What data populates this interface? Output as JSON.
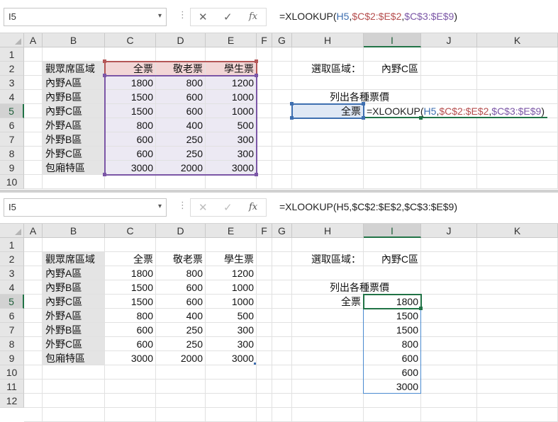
{
  "top": {
    "name_box": "I5",
    "formula_segments": [
      {
        "text": "=XLOOKUP(",
        "color": "#222222"
      },
      {
        "text": "H5",
        "color": "#3e6fb0"
      },
      {
        "text": ",",
        "color": "#222222"
      },
      {
        "text": "$C$2:$E$2",
        "color": "#b54e4e"
      },
      {
        "text": ",",
        "color": "#222222"
      },
      {
        "text": "$C$3:$E$9",
        "color": "#7b56a6"
      },
      {
        "text": ")",
        "color": "#222222"
      }
    ]
  },
  "bottom": {
    "name_box": "I5",
    "formula": "=XLOOKUP(H5,$C$2:$E$2,$C$3:$E$9)"
  },
  "toolbar": {
    "cancel_glyph": "✕",
    "enter_glyph": "✓",
    "fx_label": "fx",
    "dropdown_glyph": "▾",
    "separator": "⋮"
  },
  "columns": [
    "A",
    "B",
    "C",
    "D",
    "E",
    "F",
    "G",
    "H",
    "I",
    "J",
    "K"
  ],
  "top_rows": [
    "1",
    "2",
    "3",
    "4",
    "5",
    "6",
    "7",
    "8",
    "9",
    "10"
  ],
  "bottom_rows": [
    "1",
    "2",
    "3",
    "4",
    "5",
    "6",
    "7",
    "8",
    "9",
    "10",
    "11",
    "12"
  ],
  "table": {
    "corner_label": "觀眾席區域",
    "headers": [
      "全票",
      "敬老票",
      "學生票"
    ],
    "rows": [
      {
        "area": "內野A區",
        "values": [
          "1800",
          "800",
          "1200"
        ]
      },
      {
        "area": "內野B區",
        "values": [
          "1500",
          "600",
          "1000"
        ]
      },
      {
        "area": "內野C區",
        "values": [
          "1500",
          "600",
          "1000"
        ]
      },
      {
        "area": "外野A區",
        "values": [
          "800",
          "400",
          "500"
        ]
      },
      {
        "area": "外野B區",
        "values": [
          "600",
          "250",
          "300"
        ]
      },
      {
        "area": "外野C區",
        "values": [
          "600",
          "250",
          "300"
        ]
      },
      {
        "area": "包廂特區",
        "values": [
          "3000",
          "2000",
          "3000"
        ]
      }
    ]
  },
  "lookup": {
    "select_label": "選取區域：",
    "select_value": "內野C區",
    "list_label": "列出各種票價",
    "ticket_type": "全票",
    "editing_formula_segments": [
      {
        "text": "=XLOOKUP(",
        "color": "#222222"
      },
      {
        "text": "H5",
        "color": "#3e6fb0"
      },
      {
        "text": ",",
        "color": "#222222"
      },
      {
        "text": "$C$2:$E$2",
        "color": "#b54e4e"
      },
      {
        "text": ",",
        "color": "#222222"
      },
      {
        "text": "$C$3:$E$9",
        "color": "#7b56a6"
      },
      {
        "text": ")",
        "color": "#222222"
      }
    ],
    "spill_results": [
      "1800",
      "1500",
      "1500",
      "800",
      "600",
      "600",
      "3000"
    ]
  }
}
